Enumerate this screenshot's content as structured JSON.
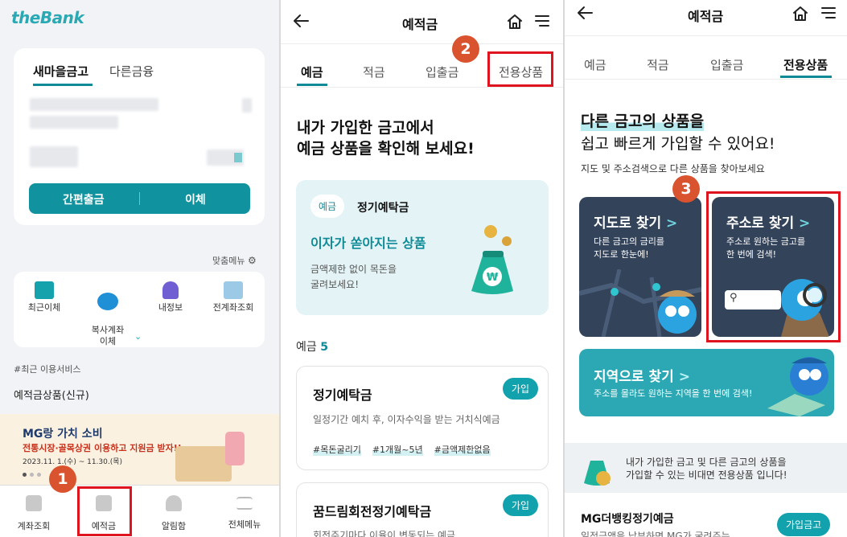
{
  "colors": {
    "accent": "#10939e",
    "highlight": "#e0141e",
    "badge": "#d9532f"
  },
  "panel1": {
    "logo": "theBank",
    "tabs": [
      "새마을금고",
      "다른금융"
    ],
    "buttons": {
      "quick_withdraw": "간편출금",
      "transfer": "이체"
    },
    "custom_menu": "맞춤메뉴",
    "quick_menu": [
      {
        "label": "최근이체",
        "icon": "recent-transfer-icon"
      },
      {
        "label": "복사계좌\n이체",
        "icon": "copy-account-icon"
      },
      {
        "label": "내정보",
        "icon": "person-icon"
      },
      {
        "label": "전계좌조회",
        "icon": "account-search-icon"
      }
    ],
    "recent_services": "#최근 이용서비스",
    "recent_link": "예적금상품(신규)",
    "banner": {
      "title": "MG랑 가치 소비",
      "subtitle": "전통시장·골목상권 이용하고 지원금 받자!!",
      "date": "2023.11. 1.(수) ~ 11.30.(목)"
    },
    "bottom_nav": [
      "계좌조회",
      "예적금",
      "알림함",
      "전체메뉴"
    ],
    "step_badge": "1"
  },
  "panel2": {
    "title": "예적금",
    "tabs": [
      "예금",
      "적금",
      "입출금",
      "전용상품"
    ],
    "step_badge": "2",
    "headline_1": "내가 가입한 금고에서",
    "headline_2": "예금 상품을 확인해 보세요!",
    "promo": {
      "pill": "예금",
      "name": "정기예탁금",
      "slogan": "이자가 쏟아지는 상품",
      "desc_1": "금액제한 없이 목돈을",
      "desc_2": "굴려보세요!"
    },
    "count_label": "예금",
    "count": "5",
    "products": [
      {
        "name": "정기예탁금",
        "join": "가입",
        "desc": "일정기간 예치 후, 이자수익을 받는 거치식예금",
        "tags": [
          "#목돈굴리기",
          "#1개월~5년",
          "#금액제한없음"
        ]
      },
      {
        "name": "꿈드림회전정기예탁금",
        "join": "가입",
        "desc": "회전주기마다 이율이 변동되는 예금"
      }
    ]
  },
  "panel3": {
    "title": "예적금",
    "tabs": [
      "예금",
      "적금",
      "입출금",
      "전용상품"
    ],
    "headline_1": "다른 금고의 상품을",
    "headline_2": "쉽고 빠르게 가입할 수 있어요!",
    "sub": "지도 및 주소검색으로 다른 상품을 찾아보세요",
    "step_badge": "3",
    "map_card": {
      "title": "지도로 찾기",
      "chevron": ">",
      "desc_1": "다른 금고의 금리를",
      "desc_2": "지도로 한눈에!"
    },
    "address_card": {
      "title": "주소로 찾기",
      "chevron": ">",
      "desc_1": "주소로 원하는 금고를",
      "desc_2": "한 번에 검색!"
    },
    "region_card": {
      "title": "지역으로 찾기",
      "chevron": ">",
      "desc": "주소를 몰라도 원하는 지역을 한 번에 검색!"
    },
    "info_1": "내가 가입한 금고 및 다른 금고의 상품을",
    "info_2": "가입할 수 있는 비대면 전용상품 입니다!",
    "product_name": "MG더뱅킹정기예금",
    "product_join": "가입금고",
    "product_desc": "일정금액을 납부하면 MG가 굴려주는"
  }
}
